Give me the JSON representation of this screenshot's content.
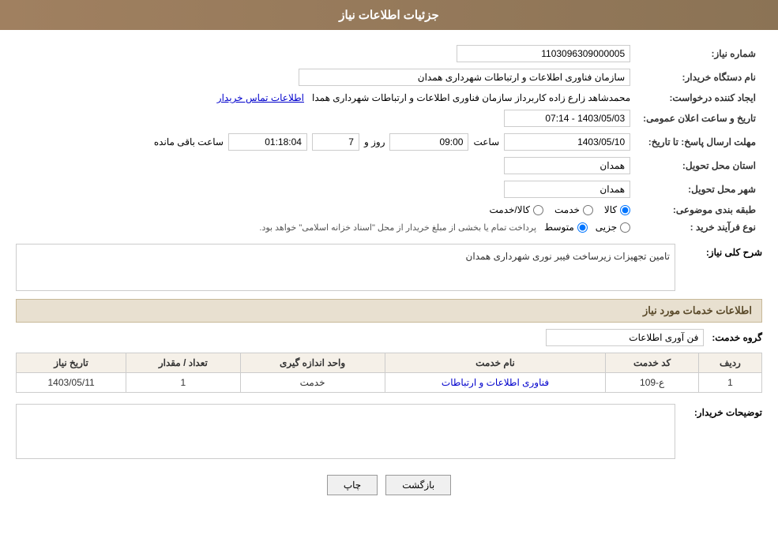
{
  "header": {
    "title": "جزئیات اطلاعات نیاز"
  },
  "fields": {
    "need_number_label": "شماره نیاز:",
    "need_number_value": "1103096309000005",
    "buyer_org_label": "نام دستگاه خریدار:",
    "buyer_org_value": "سازمان فناوری اطلاعات و ارتباطات شهرداری همدان",
    "requester_label": "ایجاد کننده درخواست:",
    "requester_value": "محمدشاهد زارع زاده کاربرداز سازمان فناوری اطلاعات و ارتباطات شهرداری همدا",
    "requester_link": "اطلاعات تماس خریدار",
    "announcement_label": "تاریخ و ساعت اعلان عمومی:",
    "announcement_value": "1403/05/03 - 07:14",
    "reply_deadline_label": "مهلت ارسال پاسخ: تا تاریخ:",
    "reply_date": "1403/05/10",
    "reply_time_label": "ساعت",
    "reply_time": "09:00",
    "reply_days_label": "روز و",
    "reply_days": "7",
    "reply_remaining_label": "ساعت باقی مانده",
    "reply_remaining": "01:18:04",
    "province_label": "استان محل تحویل:",
    "province_value": "همدان",
    "city_label": "شهر محل تحویل:",
    "city_value": "همدان",
    "category_label": "طبقه بندی موضوعی:",
    "category_options": [
      "کالا",
      "خدمت",
      "کالا/خدمت"
    ],
    "category_selected": "کالا",
    "process_type_label": "نوع فرآیند خرید :",
    "process_options": [
      "جزیی",
      "متوسط"
    ],
    "process_selected": "متوسط",
    "process_note": "پرداخت تمام یا بخشی از مبلغ خریدار از محل \"اسناد خزانه اسلامی\" خواهد بود.",
    "need_desc_label": "شرح کلی نیاز:",
    "need_desc_value": "تامین تجهیزات زیرساخت فیبر نوری شهرداری همدان",
    "services_section_label": "اطلاعات خدمات مورد نیاز",
    "service_group_label": "گروه خدمت:",
    "service_group_value": "فن آوری اطلاعات",
    "table_headers": [
      "ردیف",
      "کد خدمت",
      "نام خدمت",
      "واحد اندازه گیری",
      "تعداد / مقدار",
      "تاریخ نیاز"
    ],
    "table_rows": [
      {
        "row": "1",
        "code": "ع-109",
        "name": "فناوری اطلاعات و ارتباطات",
        "unit": "خدمت",
        "quantity": "1",
        "date": "1403/05/11"
      }
    ],
    "buyer_desc_label": "توضیحات خریدار:",
    "buyer_desc_value": ""
  },
  "buttons": {
    "print_label": "چاپ",
    "back_label": "بازگشت"
  }
}
